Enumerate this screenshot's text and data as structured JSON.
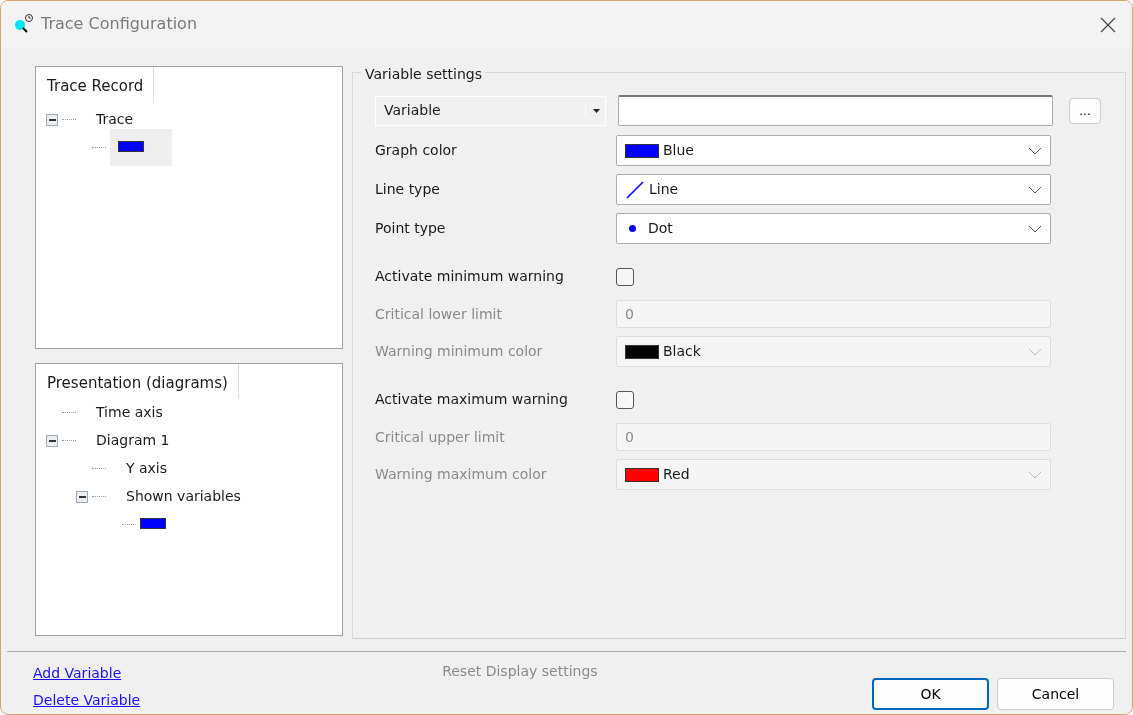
{
  "window": {
    "title": "Trace Configuration"
  },
  "trace_record": {
    "header": "Trace Record",
    "tree": [
      {
        "kind": "text",
        "label": "Trace",
        "expanded": true,
        "selected": false,
        "children": [
          {
            "kind": "swatch",
            "color": "#0000ff",
            "selected": true
          }
        ]
      }
    ]
  },
  "presentation": {
    "header": "Presentation (diagrams)",
    "tree": [
      {
        "kind": "text",
        "label": "Time axis"
      },
      {
        "kind": "text",
        "label": "Diagram 1",
        "expanded": true,
        "children": [
          {
            "kind": "text",
            "label": "Y axis"
          },
          {
            "kind": "text",
            "label": "Shown variables",
            "expanded": true,
            "children": [
              {
                "kind": "swatch",
                "color": "#0000ff"
              }
            ]
          }
        ]
      }
    ]
  },
  "variable_settings": {
    "legend": "Variable settings",
    "selector": {
      "label": "Variable"
    },
    "browse_button": "...",
    "rows": [
      {
        "kind": "color_select",
        "label": "Graph color",
        "value": "Blue",
        "color": "#0000ff",
        "disabled": false
      },
      {
        "kind": "line_select",
        "label": "Line type",
        "value": "Line",
        "color": "#0000ff",
        "disabled": false
      },
      {
        "kind": "point_select",
        "label": "Point type",
        "value": "Dot",
        "color": "#0000ff",
        "disabled": false
      },
      {
        "kind": "checkbox",
        "label": "Activate minimum warning",
        "checked": false,
        "disabled": false
      },
      {
        "kind": "number",
        "label": "Critical lower limit",
        "value": "0",
        "disabled": true
      },
      {
        "kind": "color_select",
        "label": "Warning minimum color",
        "value": "Black",
        "color": "#000000",
        "disabled": true
      },
      {
        "kind": "checkbox",
        "label": "Activate maximum warning",
        "checked": false,
        "disabled": false
      },
      {
        "kind": "number",
        "label": "Critical upper limit",
        "value": "0",
        "disabled": true
      },
      {
        "kind": "color_select",
        "label": "Warning maximum color",
        "value": "Red",
        "color": "#ff0000",
        "disabled": true
      }
    ]
  },
  "footer": {
    "links": [
      "Add Variable",
      "Delete Variable"
    ],
    "reset": {
      "label": "Reset Display settings",
      "disabled": true
    },
    "buttons": [
      {
        "label": "OK",
        "default": true
      },
      {
        "label": "Cancel",
        "default": false
      }
    ]
  }
}
